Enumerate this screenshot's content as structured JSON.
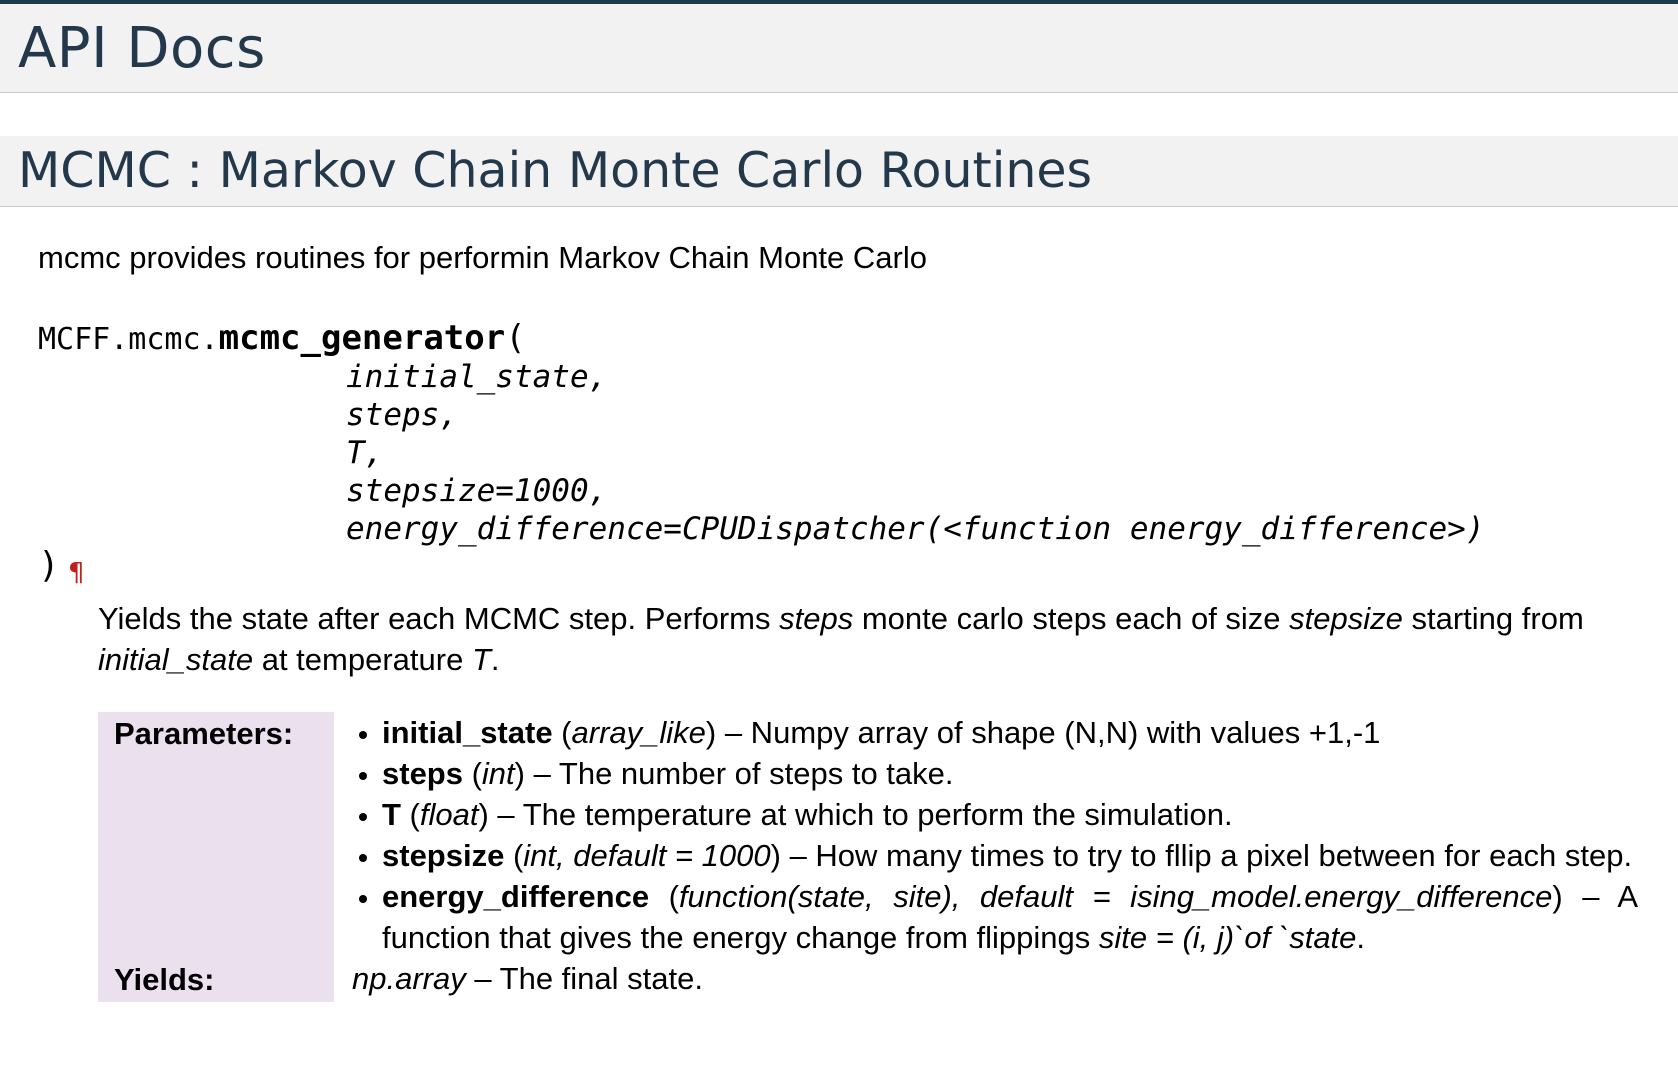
{
  "header": {
    "title": "API Docs"
  },
  "section": {
    "title": "MCMC : Markov Chain Monte Carlo Routines"
  },
  "intro": "mcmc provides routines for performin Markov Chain Monte Carlo",
  "signature": {
    "module_prefix": "MCFF.mcmc.",
    "function_name": "mcmc_generator",
    "open_paren": "(",
    "params": [
      "initial_state,",
      "steps,",
      "T,",
      "stepsize=1000,",
      "energy_difference=CPUDispatcher(<function energy_difference>)"
    ],
    "close_paren": ")",
    "permalink": "¶"
  },
  "description": {
    "p1": "Yields the state after each MCMC step. Performs ",
    "steps": "steps",
    "p2": " monte carlo steps each of size ",
    "stepsize": "stepsize",
    "p3": " starting from ",
    "initial_state": "initial_state",
    "p4": " at temperature ",
    "T": "T",
    "p5": "."
  },
  "fields": {
    "parameters_label": "Parameters:",
    "yields_label": "Yields:",
    "params": [
      {
        "name": "initial_state",
        "type": "array_like",
        "desc": " – Numpy array of shape (N,N) with values +1,-1"
      },
      {
        "name": "steps",
        "type": "int",
        "desc": " – The number of steps to take."
      },
      {
        "name": "T",
        "type": "float",
        "desc": " – The temperature at which to perform the simulation."
      },
      {
        "name": "stepsize",
        "type": "int, default = 1000",
        "desc": " – How many times to try to fllip a pixel between for each step."
      },
      {
        "name": "energy_difference",
        "type": "function(state, site), default = ising_model.energy_difference",
        "desc": " – A function that gives the energy change from flippings ",
        "desc_em": "site = (i, j)`of `state",
        "desc_end": "."
      }
    ],
    "yields": {
      "type": "np.array",
      "desc": " – The final state."
    }
  }
}
